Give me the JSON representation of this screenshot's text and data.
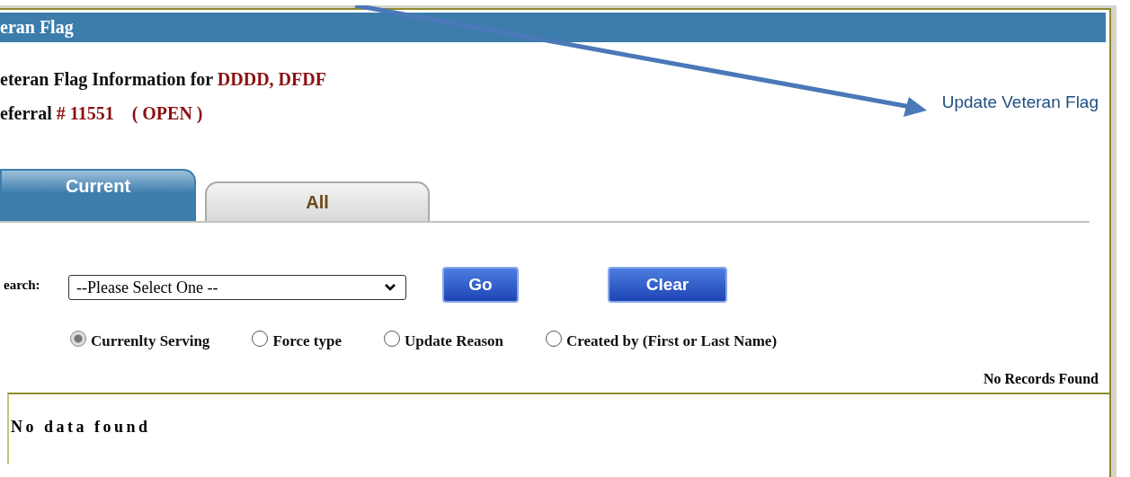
{
  "header": {
    "title": "eran Flag"
  },
  "info": {
    "label": "eteran Flag Information for",
    "name": "DDDD, DFDF"
  },
  "referral": {
    "label": "eferral",
    "number": "# 11551",
    "status": "( OPEN )"
  },
  "update_link": "Update Veteran Flag",
  "tabs": [
    {
      "label": "Current",
      "selected": true
    },
    {
      "label": "All",
      "selected": false
    }
  ],
  "search": {
    "label": "earch:",
    "value": "--Please Select One --"
  },
  "buttons": [
    "Go",
    "Clear"
  ],
  "radios": [
    {
      "label": "Currenlty Serving",
      "selected": true
    },
    {
      "label": "Force type",
      "selected": false
    },
    {
      "label": "Update Reason",
      "selected": false
    },
    {
      "label": "Created by (First or Last Name)",
      "selected": false
    }
  ],
  "records_status": "No Records Found",
  "results": {
    "message": "No data found"
  }
}
